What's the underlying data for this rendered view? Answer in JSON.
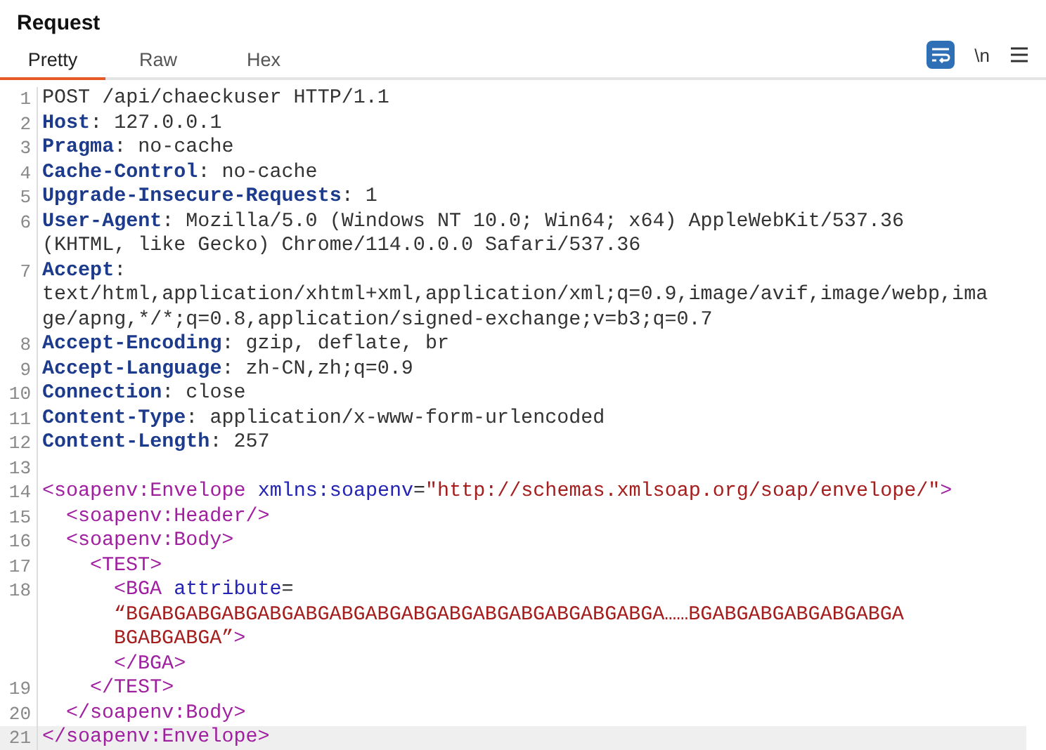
{
  "panel": {
    "title": "Request"
  },
  "tabs": [
    {
      "label": "Pretty",
      "selected": true
    },
    {
      "label": "Raw",
      "selected": false
    },
    {
      "label": "Hex",
      "selected": false
    }
  ],
  "toolbar": {
    "wrap_on": true,
    "newline_label": "\\n"
  },
  "lines": [
    {
      "number": "1",
      "current": false,
      "rows": [
        [
          {
            "kind": "plain",
            "text": "POST /api/chaeckuser HTTP/1.1"
          }
        ]
      ]
    },
    {
      "number": "2",
      "current": false,
      "rows": [
        [
          {
            "kind": "key",
            "text": "Host"
          },
          {
            "kind": "plain",
            "text": ": 127.0.0.1"
          }
        ]
      ]
    },
    {
      "number": "3",
      "current": false,
      "rows": [
        [
          {
            "kind": "key",
            "text": "Pragma"
          },
          {
            "kind": "plain",
            "text": ": no-cache"
          }
        ]
      ]
    },
    {
      "number": "4",
      "current": false,
      "rows": [
        [
          {
            "kind": "key",
            "text": "Cache-Control"
          },
          {
            "kind": "plain",
            "text": ": no-cache"
          }
        ]
      ]
    },
    {
      "number": "5",
      "current": false,
      "rows": [
        [
          {
            "kind": "key",
            "text": "Upgrade-Insecure-Requests"
          },
          {
            "kind": "plain",
            "text": ": 1"
          }
        ]
      ]
    },
    {
      "number": "6",
      "current": false,
      "rows": [
        [
          {
            "kind": "key",
            "text": "User-Agent"
          },
          {
            "kind": "plain",
            "text": ": Mozilla/5.0 (Windows NT 10.0; Win64; x64) AppleWebKit/537.36"
          }
        ],
        [
          {
            "kind": "plain",
            "text": "(KHTML, like Gecko) Chrome/114.0.0.0 Safari/537.36"
          }
        ]
      ]
    },
    {
      "number": "7",
      "current": false,
      "rows": [
        [
          {
            "kind": "key",
            "text": "Accept"
          },
          {
            "kind": "plain",
            "text": ":"
          }
        ],
        [
          {
            "kind": "plain",
            "text": "text/html,application/xhtml+xml,application/xml;q=0.9,image/avif,image/webp,ima"
          }
        ],
        [
          {
            "kind": "plain",
            "text": "ge/apng,*/*;q=0.8,application/signed-exchange;v=b3;q=0.7"
          }
        ]
      ]
    },
    {
      "number": "8",
      "current": false,
      "rows": [
        [
          {
            "kind": "key",
            "text": "Accept-Encoding"
          },
          {
            "kind": "plain",
            "text": ": gzip, deflate, br"
          }
        ]
      ]
    },
    {
      "number": "9",
      "current": false,
      "rows": [
        [
          {
            "kind": "key",
            "text": "Accept-Language"
          },
          {
            "kind": "plain",
            "text": ": zh-CN,zh;q=0.9"
          }
        ]
      ]
    },
    {
      "number": "10",
      "current": false,
      "rows": [
        [
          {
            "kind": "key",
            "text": "Connection"
          },
          {
            "kind": "plain",
            "text": ": close"
          }
        ]
      ]
    },
    {
      "number": "11",
      "current": false,
      "rows": [
        [
          {
            "kind": "key",
            "text": "Content-Type"
          },
          {
            "kind": "plain",
            "text": ": application/x-www-form-urlencoded"
          }
        ]
      ]
    },
    {
      "number": "12",
      "current": false,
      "rows": [
        [
          {
            "kind": "key",
            "text": "Content-Length"
          },
          {
            "kind": "plain",
            "text": ": 257"
          }
        ]
      ]
    },
    {
      "number": "13",
      "current": false,
      "rows": [
        []
      ]
    },
    {
      "number": "14",
      "current": false,
      "rows": [
        [
          {
            "kind": "tag",
            "text": "<soapenv:Envelope"
          },
          {
            "kind": "attr",
            "text": "xmlns:soapenv"
          },
          {
            "kind": "plain",
            "text": "="
          },
          {
            "kind": "string",
            "text": "\"http://schemas.xmlsoap.org/soap/envelope/\""
          },
          {
            "kind": "tag",
            "text": ">"
          }
        ]
      ],
      "children": [
        {
          "number": "15",
          "current": false,
          "rows": [
            [
              {
                "kind": "tag",
                "text": "<soapenv:Header/>"
              }
            ]
          ]
        },
        {
          "number": "16",
          "current": false,
          "rows": [
            [
              {
                "kind": "tag",
                "text": "<soapenv:Body>"
              }
            ]
          ],
          "children": [
            {
              "number": "17",
              "current": false,
              "rows": [
                [
                  {
                    "kind": "tag",
                    "text": "<TEST>"
                  }
                ]
              ],
              "children": [
                {
                  "number": "18",
                  "current": false,
                  "rows": [
                    [
                      {
                        "kind": "tag",
                        "text": "<BGA"
                      },
                      {
                        "kind": "attr",
                        "text": "attribute"
                      },
                      {
                        "kind": "plain",
                        "text": "="
                      }
                    ],
                    [
                      {
                        "kind": "string",
                        "text": "“BGABGABGABGABGABGABGABGABGABGABGABGABGABGABGA……BGABGABGABGABGABGA"
                      }
                    ],
                    [
                      {
                        "kind": "string",
                        "text": "BGABGABGA”"
                      },
                      {
                        "kind": "tag",
                        "text": ">"
                      }
                    ],
                    [
                      {
                        "kind": "tag",
                        "text": "</BGA>"
                      }
                    ]
                  ]
                }
              ]
            },
            {
              "number": "19",
              "current": false,
              "rows": [
                [
                  {
                    "kind": "tag",
                    "text": "</TEST>"
                  }
                ]
              ]
            }
          ]
        },
        {
          "number": "20",
          "current": false,
          "rows": [
            [
              {
                "kind": "tag",
                "text": "</soapenv:Body>"
              }
            ]
          ]
        }
      ]
    },
    {
      "number": "21",
      "current": true,
      "rows": [
        [
          {
            "kind": "tag",
            "text": "</soapenv:Envelope>"
          }
        ]
      ]
    }
  ]
}
